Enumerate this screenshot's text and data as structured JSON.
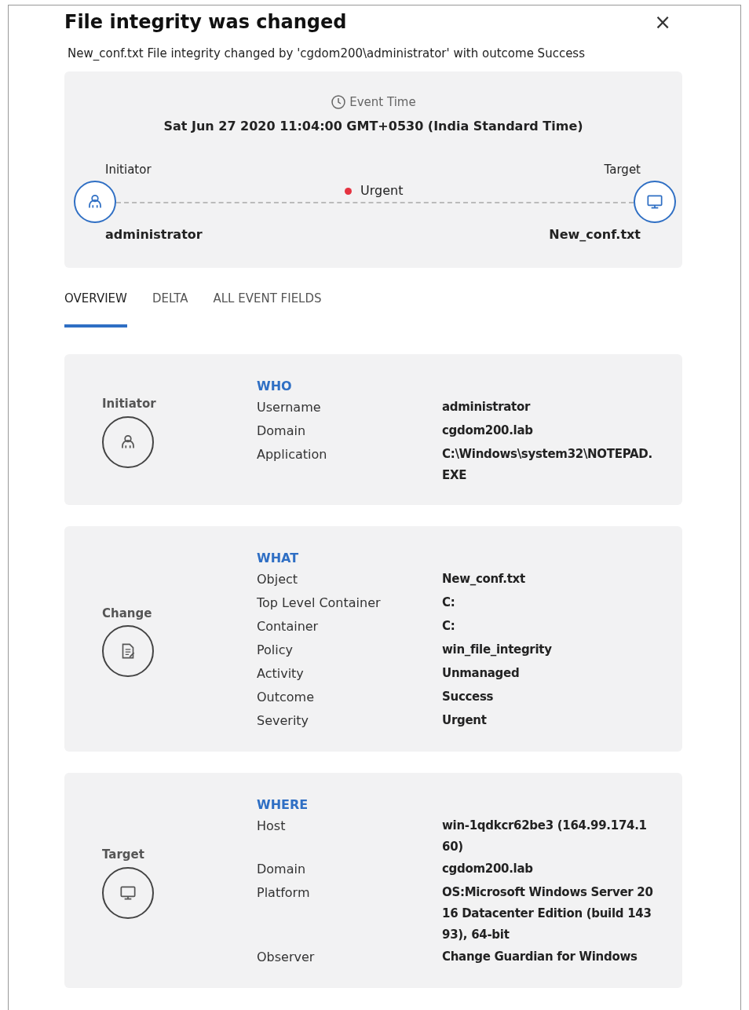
{
  "title": "File integrity was changed",
  "close": "×",
  "description": "New_conf.txt File integrity changed by 'cgdom200\\administrator' with outcome Success",
  "summary": {
    "event_time_label": "Event Time",
    "event_time": "Sat Jun 27 2020 11:04:00 GMT+0530 (India Standard Time)",
    "initiator_label": "Initiator",
    "initiator": "administrator",
    "target_label": "Target",
    "target": "New_conf.txt",
    "severity": "Urgent"
  },
  "tabs": [
    {
      "label": "OVERVIEW",
      "selected": true
    },
    {
      "label": "DELTA",
      "selected": false
    },
    {
      "label": "ALL EVENT FIELDS",
      "selected": false
    }
  ],
  "sections": [
    {
      "kind": "user",
      "role": "Initiator",
      "heading": "WHO",
      "fields": [
        {
          "label": "Username",
          "value": "administrator"
        },
        {
          "label": "Domain",
          "value": "cgdom200.lab"
        },
        {
          "label": "Application",
          "value": "C:\\Windows\\system32\\NOTEPAD.EXE"
        }
      ]
    },
    {
      "kind": "document",
      "role": "Change",
      "heading": "WHAT",
      "fields": [
        {
          "label": "Object",
          "value": "New_conf.txt"
        },
        {
          "label": "Top Level Container",
          "value": "C:"
        },
        {
          "label": "Container",
          "value": "C:"
        },
        {
          "label": "Policy",
          "value": "win_file_integrity"
        },
        {
          "label": "Activity",
          "value": "Unmanaged"
        },
        {
          "label": "Outcome",
          "value": "Success"
        },
        {
          "label": "Severity",
          "value": "Urgent"
        }
      ]
    },
    {
      "kind": "monitor",
      "role": "Target",
      "heading": "WHERE",
      "fields": [
        {
          "label": "Host",
          "value": "win-1qdkcr62be3 (164.99.174.160)"
        },
        {
          "label": "Domain",
          "value": "cgdom200.lab"
        },
        {
          "label": "Platform",
          "value": "OS:Microsoft Windows Server 2016 Datacenter Edition (build 14393), 64-bit"
        },
        {
          "label": "Observer",
          "value": "Change Guardian for Windows"
        }
      ]
    }
  ]
}
